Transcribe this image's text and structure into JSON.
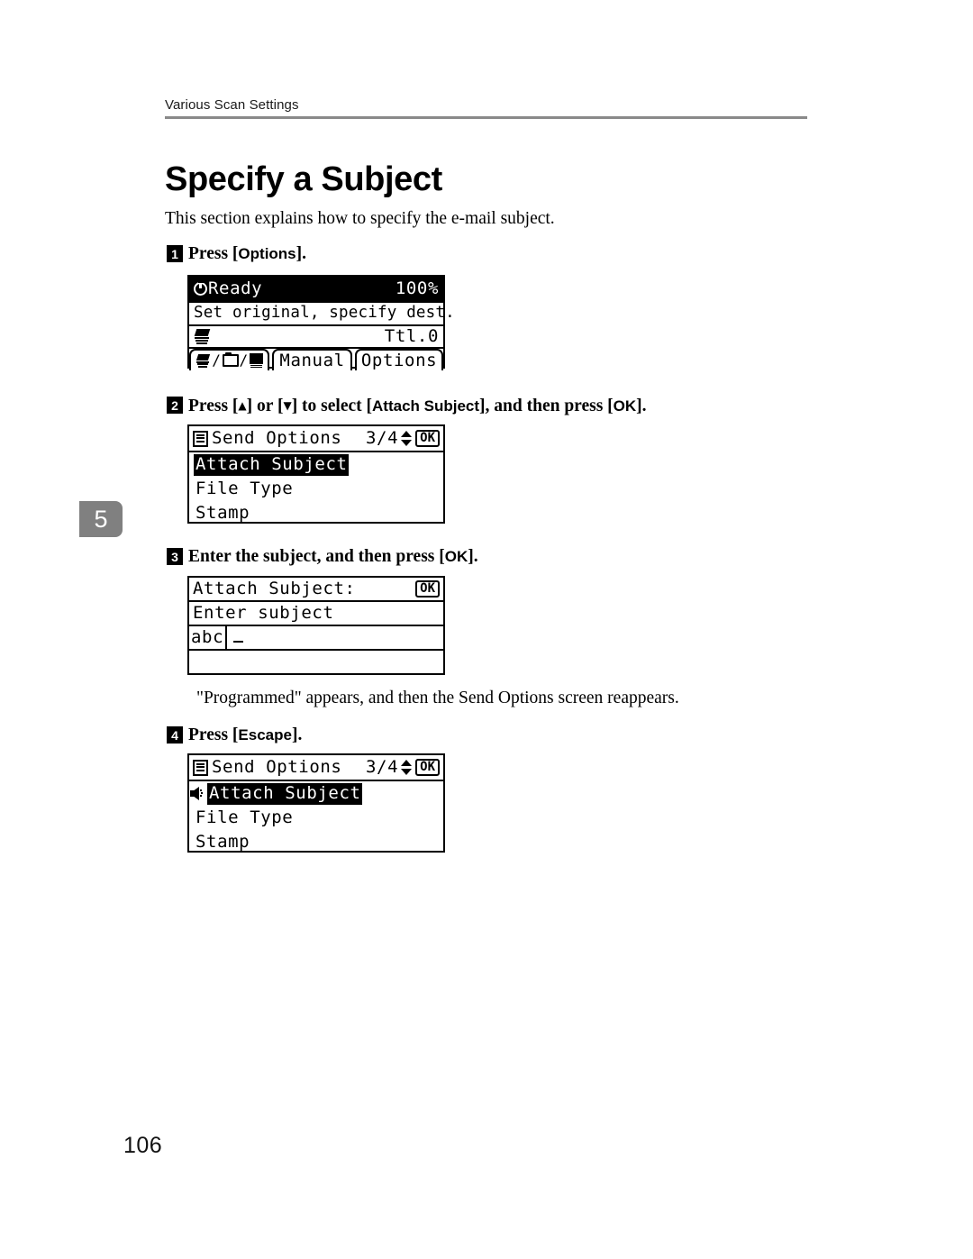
{
  "header": {
    "running_head": "Various Scan Settings"
  },
  "chapter_tab": {
    "number": "5"
  },
  "title": "Specify a Subject",
  "intro": "This section explains how to specify the e-mail subject.",
  "note": "\"Programmed\" appears, and then the Send Options screen reappears.",
  "page_number": "106",
  "steps": [
    {
      "number": "1",
      "text_before": "Press [",
      "key": "Options",
      "text_after": "]."
    },
    {
      "number": "2",
      "part1": "Press [",
      "arrow_up": "▲",
      "part2": "] or [",
      "arrow_down": "▼",
      "part3": "] to select [",
      "target": "Attach Subject",
      "part4": "], and then press [",
      "key": "OK",
      "part5": "]."
    },
    {
      "number": "3",
      "part1": "Enter the subject, and then press [",
      "key": "OK",
      "part2": "]."
    },
    {
      "number": "4",
      "part1": "Press [",
      "key": "Escape",
      "part2": "]."
    }
  ],
  "screens": {
    "ready": {
      "status": "Ready",
      "zoom": "100%",
      "message": "Set original, specify dest.",
      "total": "Ttl.0",
      "softkeys": [
        {
          "type": "icons",
          "label": "/ /"
        },
        {
          "type": "text",
          "label": "Manual"
        },
        {
          "type": "text",
          "label": "Options"
        }
      ]
    },
    "send_options_before": {
      "title": "Send Options",
      "page_indicator": "3/4",
      "ok_label": "OK",
      "items": [
        {
          "label": "Attach Subject",
          "selected": true,
          "has_speaker": false
        },
        {
          "label": "File Type",
          "selected": false,
          "has_speaker": false
        },
        {
          "label": "Stamp",
          "selected": false,
          "has_speaker": false
        }
      ]
    },
    "attach_subject_entry": {
      "title": "Attach Subject:",
      "ok_label": "OK",
      "prompt": "Enter subject",
      "ime_mode": "abc",
      "value": ""
    },
    "send_options_after": {
      "title": "Send Options",
      "page_indicator": "3/4",
      "ok_label": "OK",
      "items": [
        {
          "label": "Attach Subject",
          "selected": true,
          "has_speaker": true
        },
        {
          "label": "File Type",
          "selected": false,
          "has_speaker": false
        },
        {
          "label": "Stamp",
          "selected": false,
          "has_speaker": false
        }
      ]
    }
  }
}
